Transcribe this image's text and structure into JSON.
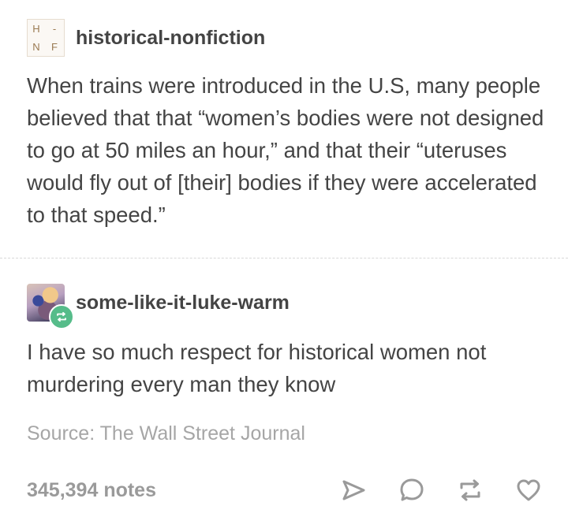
{
  "post": {
    "original": {
      "avatar_letters": [
        "H",
        "-",
        "N",
        "F"
      ],
      "blog_name": "historical-nonfiction",
      "text": "When trains were introduced in the U.S, many people believed that that “women’s bodies were not designed to go at 50 miles an hour,” and that their “uteruses would fly out of [their] bodies if they were accelerated to that speed.”"
    },
    "reblog": {
      "blog_name": "some-like-it-luke-warm",
      "text": "I have so much respect for historical women not murdering every man they know"
    },
    "source": "Source: The Wall Street Journal",
    "notes": "345,394 notes",
    "actions": [
      {
        "name": "share-icon"
      },
      {
        "name": "reply-icon"
      },
      {
        "name": "reblog-icon"
      },
      {
        "name": "like-icon"
      }
    ],
    "colors": {
      "text": "#444444",
      "muted": "#a6a6a6",
      "reblog_badge": "#56bc8a"
    }
  }
}
